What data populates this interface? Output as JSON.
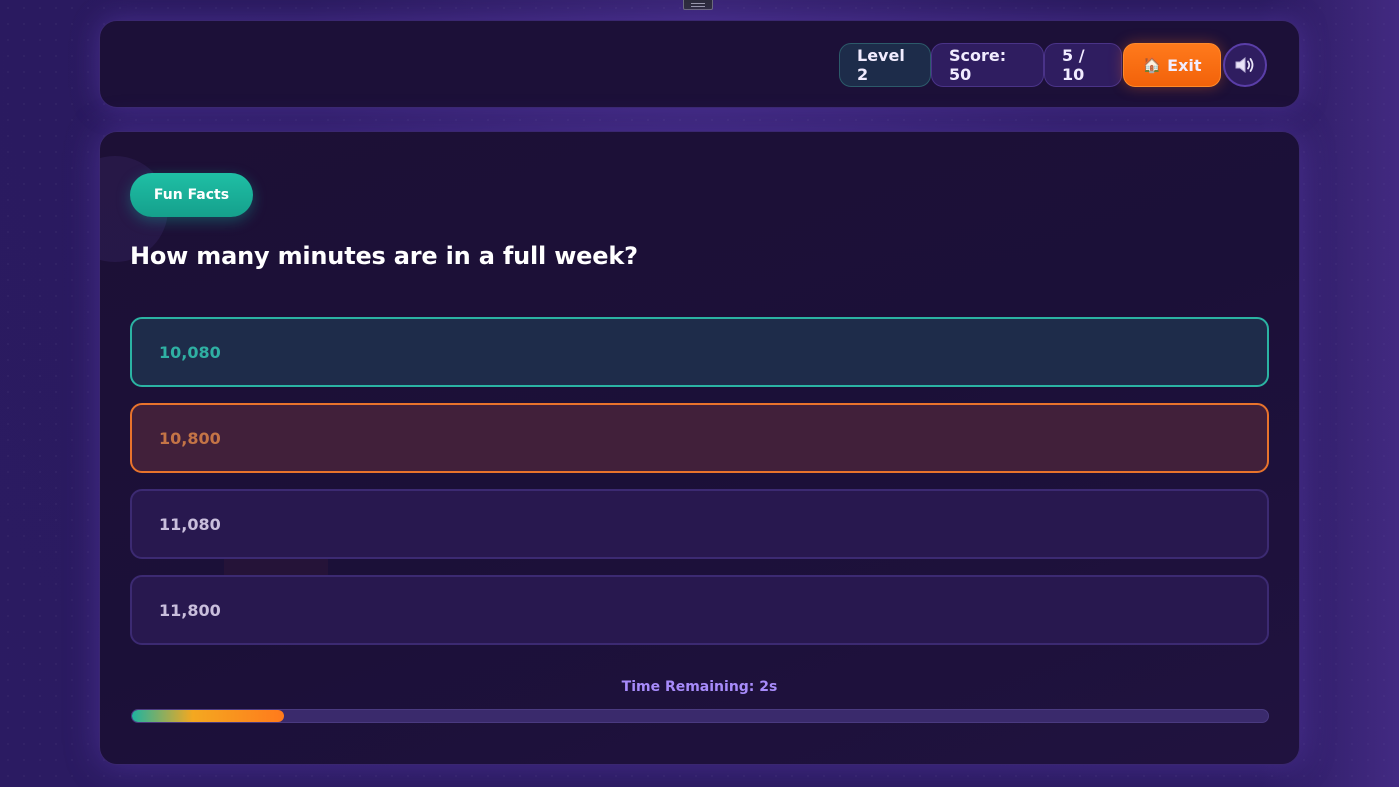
{
  "header": {
    "level_label": "Level 2",
    "score_label": "Score: 50",
    "progress_label": "5 / 10",
    "exit_label": "Exit",
    "exit_icon": "home-icon",
    "sound_icon": "speaker-icon"
  },
  "quiz": {
    "category": "Fun Facts",
    "question": "How many minutes are in a full week?",
    "answers": [
      {
        "label": "10,080",
        "state": "correct"
      },
      {
        "label": "10,800",
        "state": "wrong"
      },
      {
        "label": "11,080",
        "state": "neutral"
      },
      {
        "label": "11,800",
        "state": "neutral"
      }
    ],
    "timer_label": "Time Remaining: 2s",
    "timer_fraction": 0.134
  },
  "colors": {
    "accent_teal": "#1fb8a2",
    "accent_orange": "#ff7a1c",
    "background": "#2d1c62",
    "panel": "#1c1038",
    "timer_text": "#a78bfa"
  }
}
